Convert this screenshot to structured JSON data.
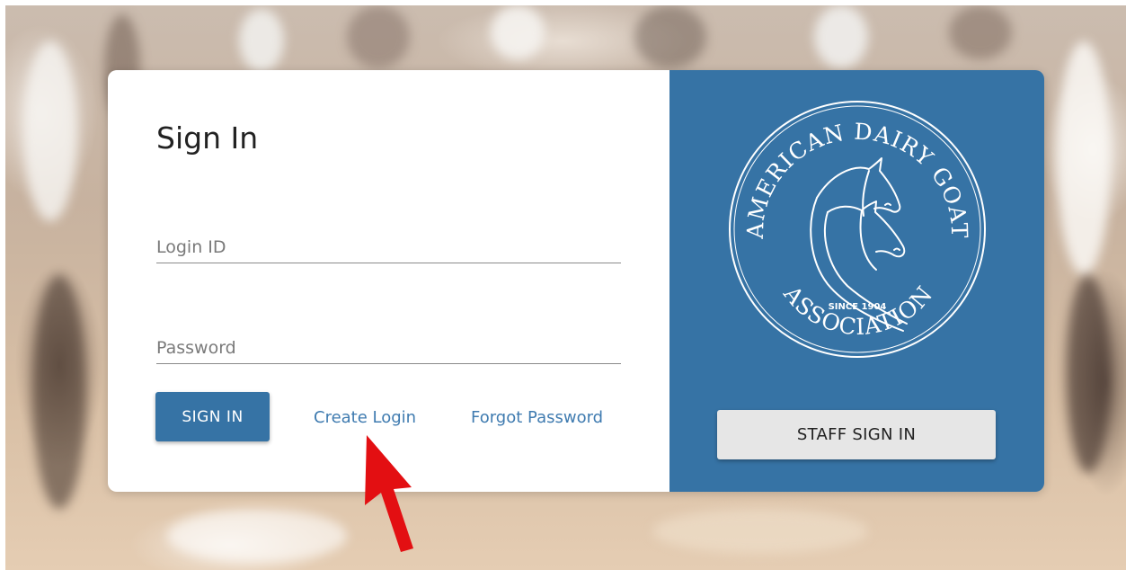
{
  "signin": {
    "title": "Sign In",
    "login_id_placeholder": "Login ID",
    "login_id_value": "",
    "password_placeholder": "Password",
    "password_value": "",
    "signin_button": "SIGN IN",
    "create_login_link": "Create Login",
    "forgot_password_link": "Forgot Password"
  },
  "branding": {
    "logo_text_top": "AMERICAN DAIRY GOAT",
    "logo_text_bottom": "ASSOCIATION",
    "logo_since": "SINCE 1904",
    "staff_signin_button": "STAFF SIGN IN"
  },
  "annotation": {
    "icon": "red-arrow-icon",
    "color": "#e30f12"
  },
  "colors": {
    "brand_blue": "#3673a5",
    "link_blue": "#3f7bb0",
    "card_white": "#ffffff",
    "staff_button_gray": "#e6e6e6"
  }
}
